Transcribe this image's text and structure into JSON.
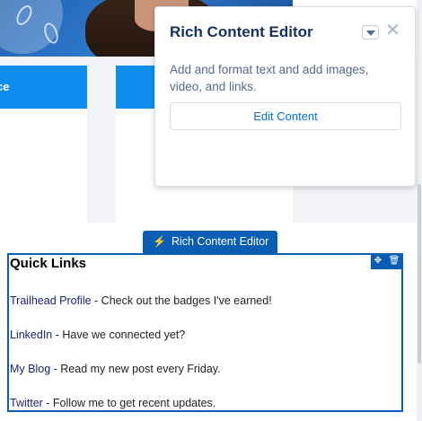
{
  "popover": {
    "title": "Rich Content Editor",
    "description": "Add and format text and add images, video, and links.",
    "edit_button": "Edit Content"
  },
  "component_tab": {
    "label": "Rich Content Editor"
  },
  "quick_links": {
    "title": "Quick Links",
    "items": [
      {
        "link": "Trailhead Profile",
        "text": " - Check out the badges I've earned!"
      },
      {
        "link": "LinkedIn",
        "text": " - Have we connected yet?"
      },
      {
        "link": "My Blog",
        "text": " - Read my new post every Friday."
      },
      {
        "link": "Twitter",
        "text": " - Follow me to get recent updates."
      }
    ]
  },
  "background_tile": {
    "label_fragment": "ce"
  },
  "colors": {
    "brand_blue": "#0a5fb4",
    "tile_blue": "#0d8ded",
    "link_blue": "#0070d2"
  }
}
